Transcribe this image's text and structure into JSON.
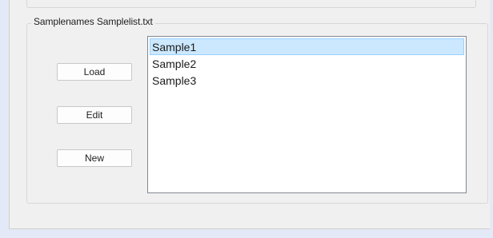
{
  "groupbox": {
    "title": "Samplenames Samplelist.txt"
  },
  "buttons": {
    "load_label": "Load",
    "edit_label": "Edit",
    "new_label": "New"
  },
  "samples": {
    "selected_index": 0,
    "items": [
      {
        "label": "Sample1"
      },
      {
        "label": "Sample2"
      },
      {
        "label": "Sample3"
      }
    ]
  },
  "colors": {
    "window_background": "#e3e9f7",
    "pane_background": "#f0f0f0",
    "selection_fill": "#cce8ff",
    "selection_border": "#99d1ff"
  }
}
